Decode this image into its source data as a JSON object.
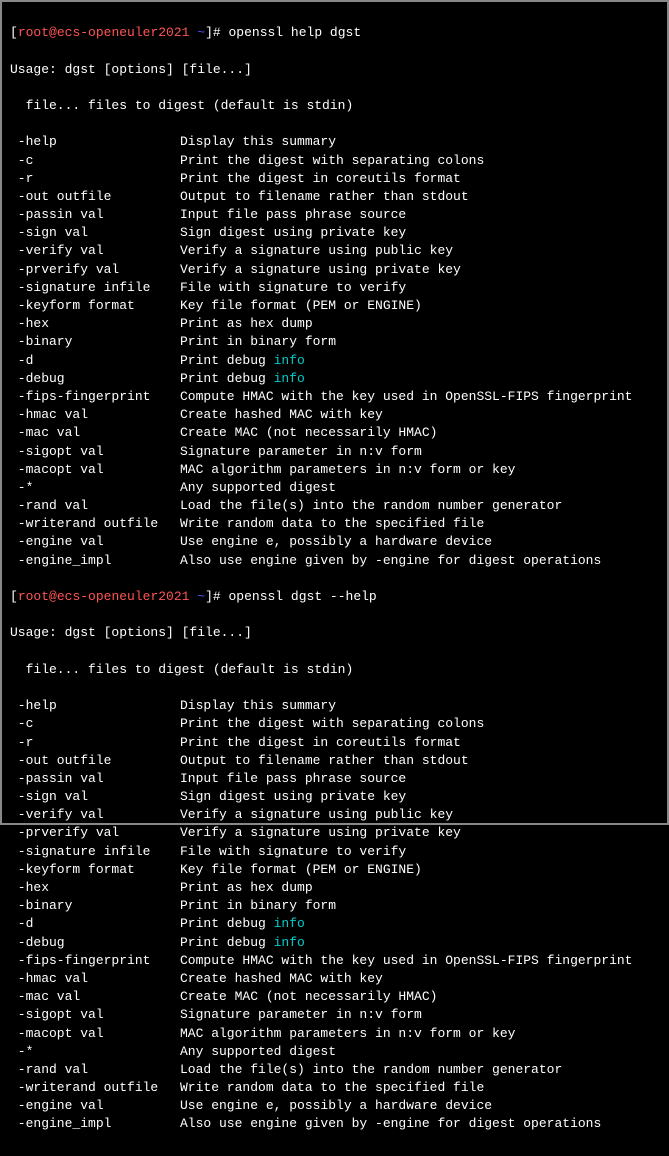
{
  "prompt1": {
    "user": "root",
    "at": "@",
    "host": "ecs-openeuler2021",
    "path": "~",
    "command": "openssl help dgst"
  },
  "usage": "Usage: dgst [options] [file...]",
  "file_desc": "  file... files to digest (default is stdin)",
  "options": [
    {
      "opt": " -help",
      "desc": "Display this summary"
    },
    {
      "opt": " -c",
      "desc": "Print the digest with separating colons"
    },
    {
      "opt": " -r",
      "desc": "Print the digest in coreutils format"
    },
    {
      "opt": " -out outfile",
      "desc": "Output to filename rather than stdout"
    },
    {
      "opt": " -passin val",
      "desc": "Input file pass phrase source"
    },
    {
      "opt": " -sign val",
      "desc": "Sign digest using private key"
    },
    {
      "opt": " -verify val",
      "desc": "Verify a signature using public key"
    },
    {
      "opt": " -prverify val",
      "desc": "Verify a signature using private key"
    },
    {
      "opt": " -signature infile",
      "desc": "File with signature to verify"
    },
    {
      "opt": " -keyform format",
      "desc": "Key file format (PEM or ENGINE)"
    },
    {
      "opt": " -hex",
      "desc": "Print as hex dump"
    },
    {
      "opt": " -binary",
      "desc": "Print in binary form"
    },
    {
      "opt": " -d",
      "desc_pre": "Print debug ",
      "desc_cyan": "info"
    },
    {
      "opt": " -debug",
      "desc_pre": "Print debug ",
      "desc_cyan": "info"
    },
    {
      "opt": " -fips-fingerprint",
      "desc": "Compute HMAC with the key used in OpenSSL-FIPS fingerprint"
    },
    {
      "opt": " -hmac val",
      "desc": "Create hashed MAC with key"
    },
    {
      "opt": " -mac val",
      "desc": "Create MAC (not necessarily HMAC)"
    },
    {
      "opt": " -sigopt val",
      "desc": "Signature parameter in n:v form"
    },
    {
      "opt": " -macopt val",
      "desc": "MAC algorithm parameters in n:v form or key"
    },
    {
      "opt": " -*",
      "desc": "Any supported digest"
    },
    {
      "opt": " -rand val",
      "desc": "Load the file(s) into the random number generator"
    },
    {
      "opt": " -writerand outfile",
      "desc": "Write random data to the specified file"
    },
    {
      "opt": " -engine val",
      "desc": "Use engine e, possibly a hardware device"
    },
    {
      "opt": " -engine_impl",
      "desc": "Also use engine given by -engine for digest operations"
    }
  ],
  "prompt2": {
    "user": "root",
    "at": "@",
    "host": "ecs-openeuler2021",
    "path": "~",
    "command": "openssl dgst --help"
  }
}
